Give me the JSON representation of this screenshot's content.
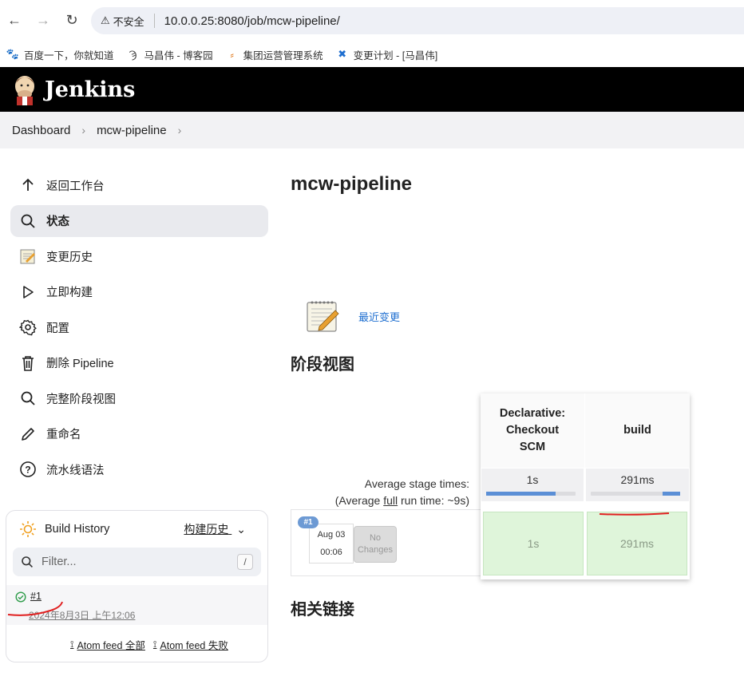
{
  "browser": {
    "security_label": "不安全",
    "url": "10.0.0.25:8080/job/mcw-pipeline/",
    "bookmarks": [
      {
        "label": "百度一下，你就知道",
        "icon": "baidu-icon"
      },
      {
        "label": "马昌伟 - 博客园",
        "icon": "cnblogs-icon"
      },
      {
        "label": "集团运营管理系统",
        "icon": "ops-system-icon"
      },
      {
        "label": "变更计划 - [马昌伟]",
        "icon": "confluence-icon"
      }
    ]
  },
  "header": {
    "title": "Jenkins"
  },
  "breadcrumb": {
    "items": [
      "Dashboard",
      "mcw-pipeline"
    ]
  },
  "sidebar": {
    "items": [
      {
        "label": "返回工作台",
        "icon": "arrow-up-icon"
      },
      {
        "label": "状态",
        "icon": "search-icon"
      },
      {
        "label": "变更历史",
        "icon": "notepad-icon"
      },
      {
        "label": "立即构建",
        "icon": "play-icon"
      },
      {
        "label": "配置",
        "icon": "gear-icon"
      },
      {
        "label": "删除 Pipeline",
        "icon": "trash-icon"
      },
      {
        "label": "完整阶段视图",
        "icon": "search-icon"
      },
      {
        "label": "重命名",
        "icon": "pencil-icon"
      },
      {
        "label": "流水线语法",
        "icon": "help-icon"
      }
    ]
  },
  "build_history": {
    "title": "Build History",
    "history_link": "构建历史",
    "filter_placeholder": "Filter...",
    "shortcut": "/",
    "builds": [
      {
        "number": "#1",
        "date": "2024年8月3日 上午12:06",
        "status": "success"
      }
    ],
    "feed_all": "Atom feed 全部",
    "feed_failed": "Atom feed 失败"
  },
  "main": {
    "title": "mcw-pipeline",
    "recent_changes": "最近变更",
    "stage_view_title": "阶段视图",
    "related_links_title": "相关链接"
  },
  "stage_view": {
    "avg_stage_times_label": "Average stage times:",
    "avg_run_prefix": "(Average ",
    "avg_run_full": "full",
    "avg_run_suffix": " run time: ~9s)",
    "stages": [
      {
        "name": "Declarative: Checkout SCM",
        "avg": "1s",
        "avg_fraction": 0.78
      },
      {
        "name": "build",
        "avg": "291ms",
        "avg_fraction": 0.2
      }
    ],
    "runs": [
      {
        "badge": "#1",
        "month_day": "Aug 03",
        "time": "00:06",
        "changes": "No Changes",
        "durations": [
          "1s",
          "291ms"
        ]
      }
    ]
  },
  "colors": {
    "header_bg": "#000000",
    "link": "#1f6fd0",
    "success_cell": "#dff5da",
    "bar": "#5b8fd6",
    "annotation": "#e02020"
  }
}
